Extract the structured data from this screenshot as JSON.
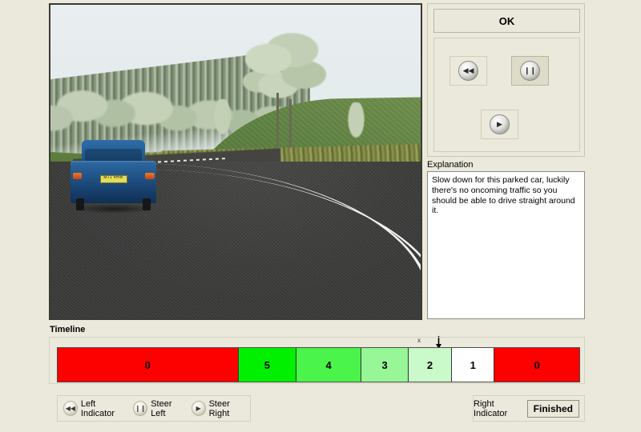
{
  "scene": {
    "description": "Driving simulator first-person view of a rural road curving right, with a blue car parked on the left verge, hedgerow and grassy hill on the right, trees on the horizon",
    "car": {
      "body_color": "#1d4f85",
      "plate_text": "M71 4HW",
      "plate_color": "#e3dd58"
    },
    "road": {
      "surface_color": "#3b3c3a",
      "line_color": "#ffffff",
      "line_type": "double white line"
    },
    "sky_color": "#e6ecee",
    "grass_color": "#5b7f3f",
    "hedge_color": "#7a8442"
  },
  "controls": {
    "ok_label": "OK",
    "buttons": [
      {
        "name": "rewind",
        "glyph": "◀◀",
        "selected": false
      },
      {
        "name": "pause",
        "glyph": "❙❙",
        "selected": true
      },
      {
        "name": "play",
        "glyph": "▶",
        "selected": false
      }
    ]
  },
  "explanation": {
    "label": "Explanation",
    "text": "Slow down for this parked car, luckily there's no oncoming traffic so you should be able to drive straight around it."
  },
  "timeline": {
    "label": "Timeline",
    "marker_label": "x",
    "marker_arrow": "↓",
    "segments": [
      {
        "value": "0",
        "color": "#fd0000",
        "width_pct": 37.6
      },
      {
        "value": "5",
        "color": "#00f000",
        "width_pct": 12.1
      },
      {
        "value": "4",
        "color": "#4af44a",
        "width_pct": 13.5
      },
      {
        "value": "3",
        "color": "#97f797",
        "width_pct": 9.8
      },
      {
        "value": "2",
        "color": "#caf9ca",
        "width_pct": 9.0
      },
      {
        "value": "1",
        "color": "#ffffff",
        "width_pct": 8.9
      },
      {
        "value": "0",
        "color": "#fd0000",
        "width_pct": 17.6
      }
    ]
  },
  "legend": {
    "items": [
      {
        "glyph": "◀◀",
        "label": "Left Indicator"
      },
      {
        "glyph": "❙❙",
        "label": "Steer Left"
      },
      {
        "glyph": "▶",
        "label": "Steer Right"
      }
    ]
  },
  "status": {
    "right_indicator_label": "Right Indicator",
    "finished_label": "Finished"
  },
  "colors": {
    "app_background": "#ebe9dc",
    "panel_border": "#cfccba",
    "selected_button": "#dedbc8"
  }
}
